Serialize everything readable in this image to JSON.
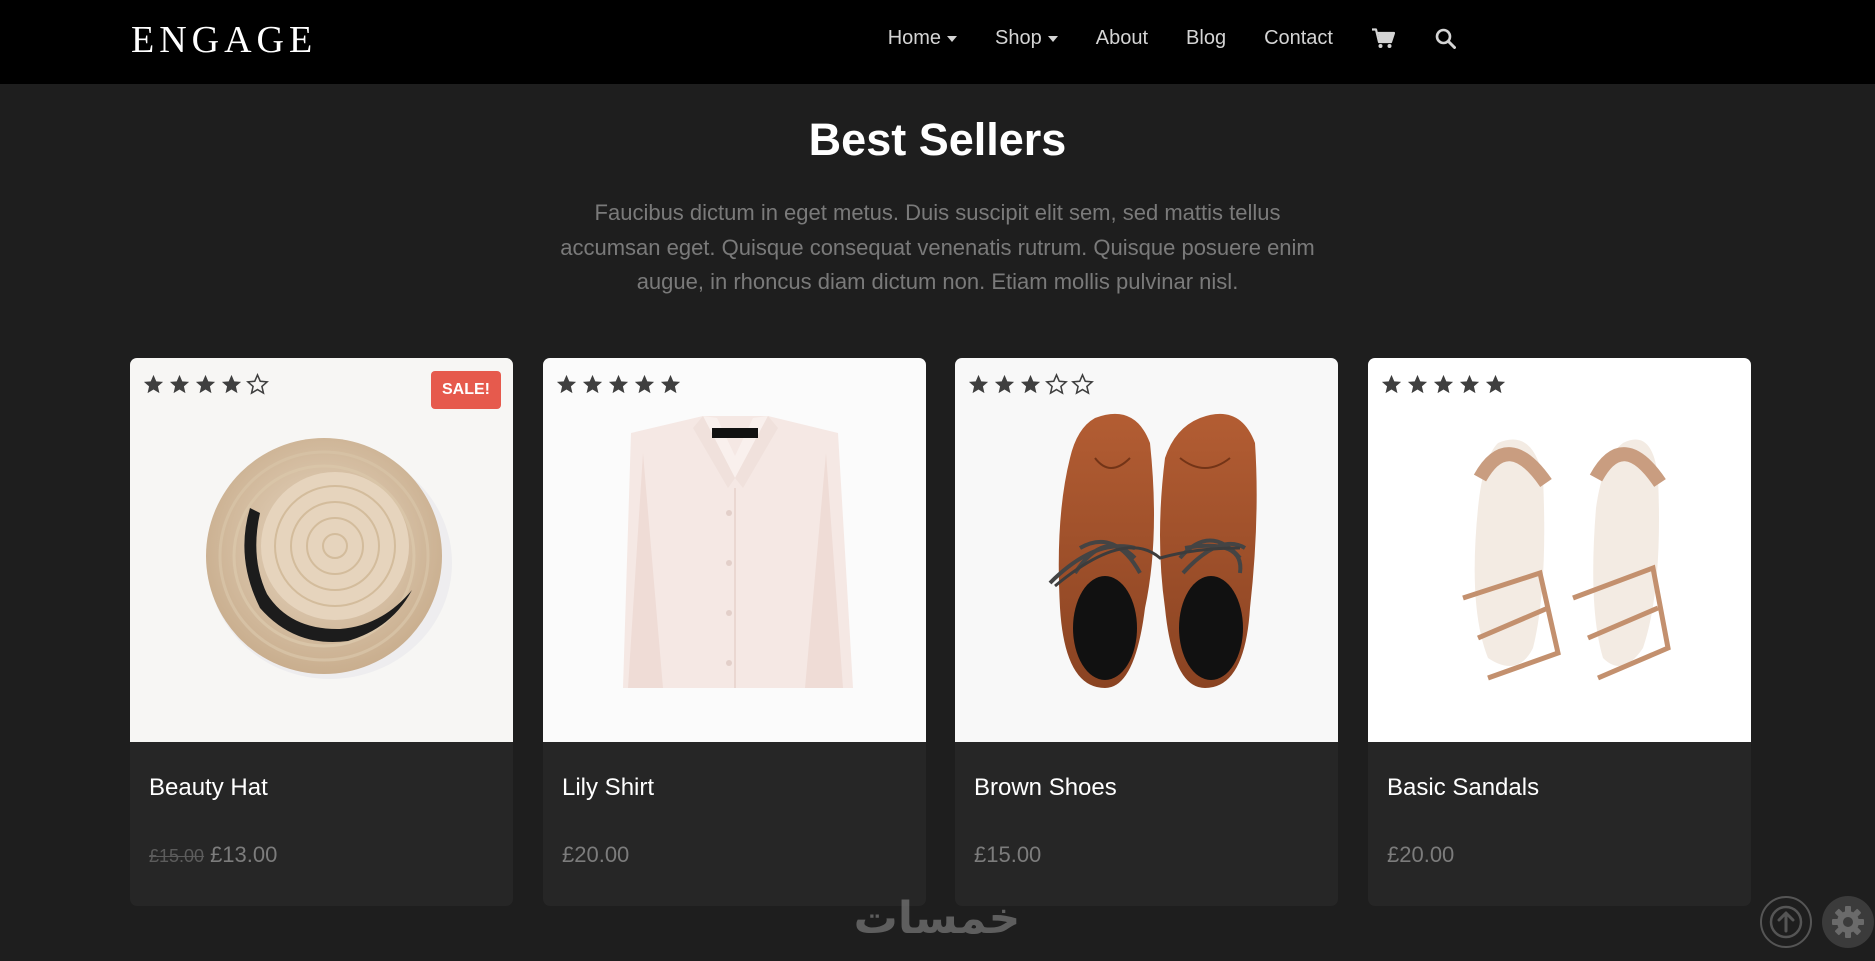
{
  "brand": "ENGAGE",
  "nav": {
    "items": [
      {
        "label": "Home",
        "dropdown": true
      },
      {
        "label": "Shop",
        "dropdown": true
      },
      {
        "label": "About",
        "dropdown": false
      },
      {
        "label": "Blog",
        "dropdown": false
      },
      {
        "label": "Contact",
        "dropdown": false
      }
    ],
    "icons": [
      "cart-icon",
      "search-icon"
    ]
  },
  "section": {
    "title": "Best Sellers",
    "description": "Faucibus dictum in eget metus. Duis suscipit elit sem, sed mattis tellus accumsan eget. Quisque consequat venenatis rutrum. Quisque posuere enim augue, in rhoncus diam dictum non. Etiam mollis pulvinar nisl."
  },
  "products": [
    {
      "name": "Beauty Hat",
      "rating": 4,
      "sale_badge": "SALE!",
      "old_price": "£15.00",
      "price": "£13.00",
      "image": "straw-hat"
    },
    {
      "name": "Lily Shirt",
      "rating": 5,
      "price": "£20.00",
      "image": "folded-shirt"
    },
    {
      "name": "Brown Shoes",
      "rating": 3,
      "price": "£15.00",
      "image": "brown-brogues"
    },
    {
      "name": "Basic Sandals",
      "rating": 5,
      "price": "£20.00",
      "image": "beige-sandals"
    }
  ],
  "watermark": "خمسات",
  "colors": {
    "sale": "#e65a4d",
    "navbar": "#000000",
    "background": "#1e1e1e",
    "card": "#262626"
  },
  "floating_buttons": [
    "scroll-to-top-icon",
    "settings-gear-icon"
  ]
}
